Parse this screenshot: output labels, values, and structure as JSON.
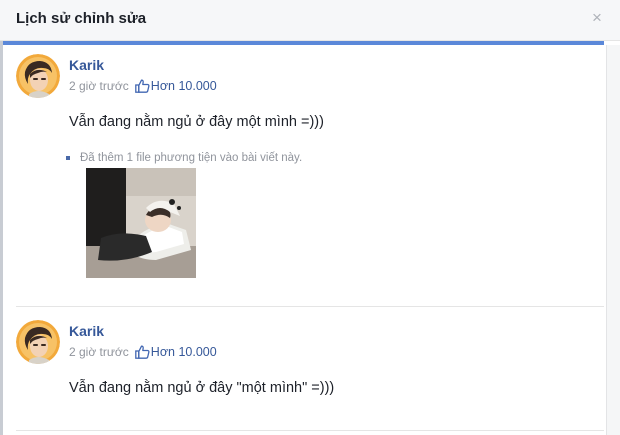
{
  "dialog": {
    "title": "Lịch sử chỉnh sửa",
    "close_symbol": "×"
  },
  "colors": {
    "accent": "#5b88d9",
    "link": "#365899",
    "text": "#1d2129",
    "meta": "#90949c"
  },
  "icons": [
    "close-icon",
    "like-icon",
    "bullet-icon"
  ],
  "edits": [
    {
      "author": "Karik",
      "time": "2 giờ trước",
      "likes": "Hơn 10.000",
      "text": "Vẫn đang nằm ngủ ở đây một mình =)))",
      "change_note": "Đã thêm 1 file phương tiện vào bài viết này."
    },
    {
      "author": "Karik",
      "time": "2 giờ trước",
      "likes": "Hơn 10.000",
      "text": "Vẫn đang nằm ngủ ở đây \"một mình\" =)))"
    }
  ]
}
